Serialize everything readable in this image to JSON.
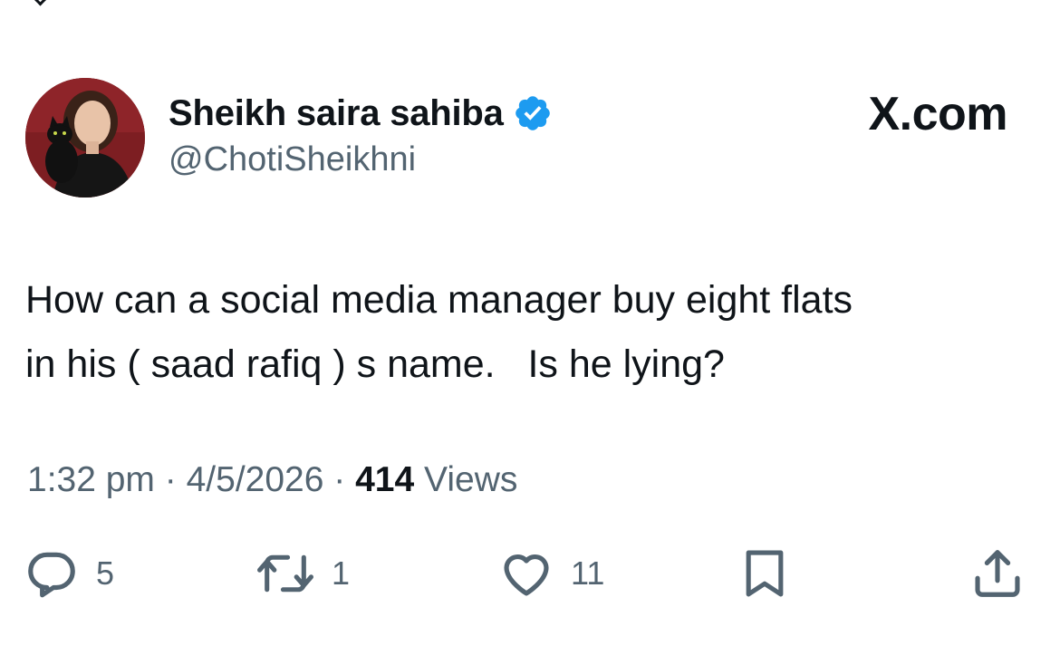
{
  "author": {
    "display_name": "Sheikh saira sahiba",
    "handle": "@ChotiSheikhni",
    "verified": true
  },
  "site": {
    "label": "X.com"
  },
  "tweet": {
    "text": "How can a social media manager buy eight flats\nin his ( saad rafiq ) s name.   Is he lying?",
    "time": "1:32 pm",
    "date": "4/5/2026",
    "separator": "·",
    "views_count": "414",
    "views_label": "Views"
  },
  "actions": {
    "reply_count": "5",
    "retweet_count": "1",
    "like_count": "11"
  },
  "icons": {
    "reply": "reply-icon",
    "retweet": "retweet-icon",
    "like": "heart-icon",
    "bookmark": "bookmark-icon",
    "share": "share-icon",
    "verified": "verified-badge-icon"
  },
  "colors": {
    "text": "#0f1419",
    "secondary": "#536471",
    "verified_blue": "#1d9bf0"
  }
}
